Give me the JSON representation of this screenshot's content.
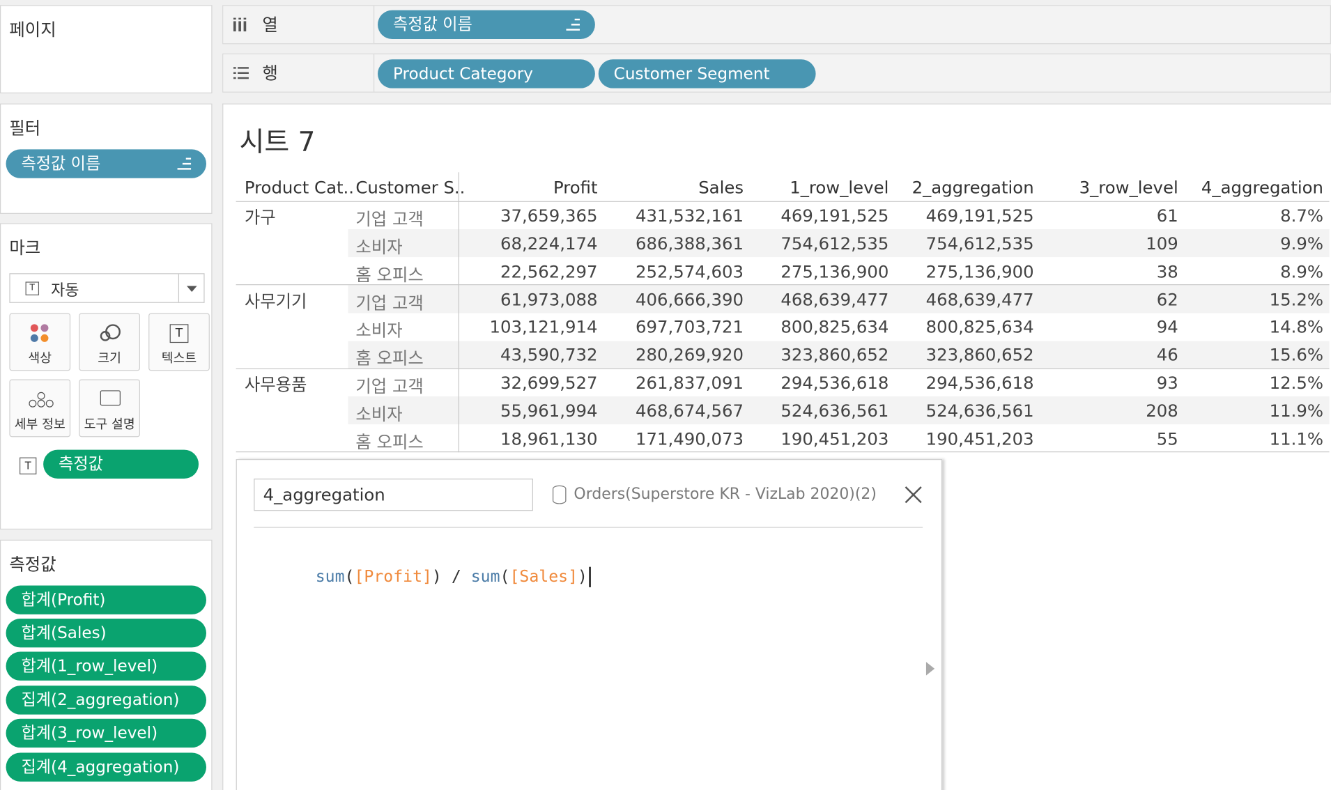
{
  "shelves": {
    "pages_title": "페이지",
    "columns_label": "열",
    "rows_label": "행",
    "columns_pill": "측정값 이름",
    "rows_pills": [
      "Product Category",
      "Customer Segment"
    ]
  },
  "filters": {
    "title": "필터",
    "pill": "측정값 이름"
  },
  "marks": {
    "title": "마크",
    "type_value": "자동",
    "buttons": [
      "색상",
      "크기",
      "텍스트",
      "세부 정보",
      "도구 설명"
    ],
    "text_pill": "측정값"
  },
  "measure_values": {
    "title": "측정값",
    "pills": [
      "합계(Profit)",
      "합계(Sales)",
      "합계(1_row_level)",
      "집계(2_aggregation)",
      "합계(3_row_level)",
      "집계(4_aggregation)"
    ]
  },
  "sheet": {
    "title": "시트 7",
    "headers": [
      "Product Cat..",
      "Customer S..",
      "Profit",
      "Sales",
      "1_row_level",
      "2_aggregation",
      "3_row_level",
      "4_aggregation"
    ],
    "groups": [
      {
        "category": "가구",
        "rows": [
          {
            "segment": "기업 고객",
            "values": [
              "37,659,365",
              "431,532,161",
              "469,191,525",
              "469,191,525",
              "61",
              "8.7%"
            ]
          },
          {
            "segment": "소비자",
            "values": [
              "68,224,174",
              "686,388,361",
              "754,612,535",
              "754,612,535",
              "109",
              "9.9%"
            ]
          },
          {
            "segment": "홈 오피스",
            "values": [
              "22,562,297",
              "252,574,603",
              "275,136,900",
              "275,136,900",
              "38",
              "8.9%"
            ]
          }
        ]
      },
      {
        "category": "사무기기",
        "rows": [
          {
            "segment": "기업 고객",
            "values": [
              "61,973,088",
              "406,666,390",
              "468,639,477",
              "468,639,477",
              "62",
              "15.2%"
            ]
          },
          {
            "segment": "소비자",
            "values": [
              "103,121,914",
              "697,703,721",
              "800,825,634",
              "800,825,634",
              "94",
              "14.8%"
            ]
          },
          {
            "segment": "홈 오피스",
            "values": [
              "43,590,732",
              "280,269,920",
              "323,860,652",
              "323,860,652",
              "46",
              "15.6%"
            ]
          }
        ]
      },
      {
        "category": "사무용품",
        "rows": [
          {
            "segment": "기업 고객",
            "values": [
              "32,699,527",
              "261,837,091",
              "294,536,618",
              "294,536,618",
              "93",
              "12.5%"
            ]
          },
          {
            "segment": "소비자",
            "values": [
              "55,961,994",
              "468,674,567",
              "524,636,561",
              "524,636,561",
              "208",
              "11.9%"
            ]
          },
          {
            "segment": "홈 오피스",
            "values": [
              "18,961,130",
              "171,490,073",
              "190,451,203",
              "190,451,203",
              "55",
              "11.1%"
            ]
          }
        ]
      }
    ]
  },
  "calc_editor": {
    "name_value": "4_aggregation",
    "datasource": "Orders(Superstore KR - VizLab 2020)(2)",
    "formula": {
      "t1": "sum",
      "t2": "(",
      "t3": "[Profit]",
      "t4": ")",
      "t5": " / ",
      "t6": "sum",
      "t7": "(",
      "t8": "[Sales]",
      "t9": ")"
    }
  },
  "colors": {
    "blue_pill": "#4996b2",
    "green_pill": "#0aa36f",
    "function": "#4a7ba7",
    "field": "#f08a3c"
  }
}
